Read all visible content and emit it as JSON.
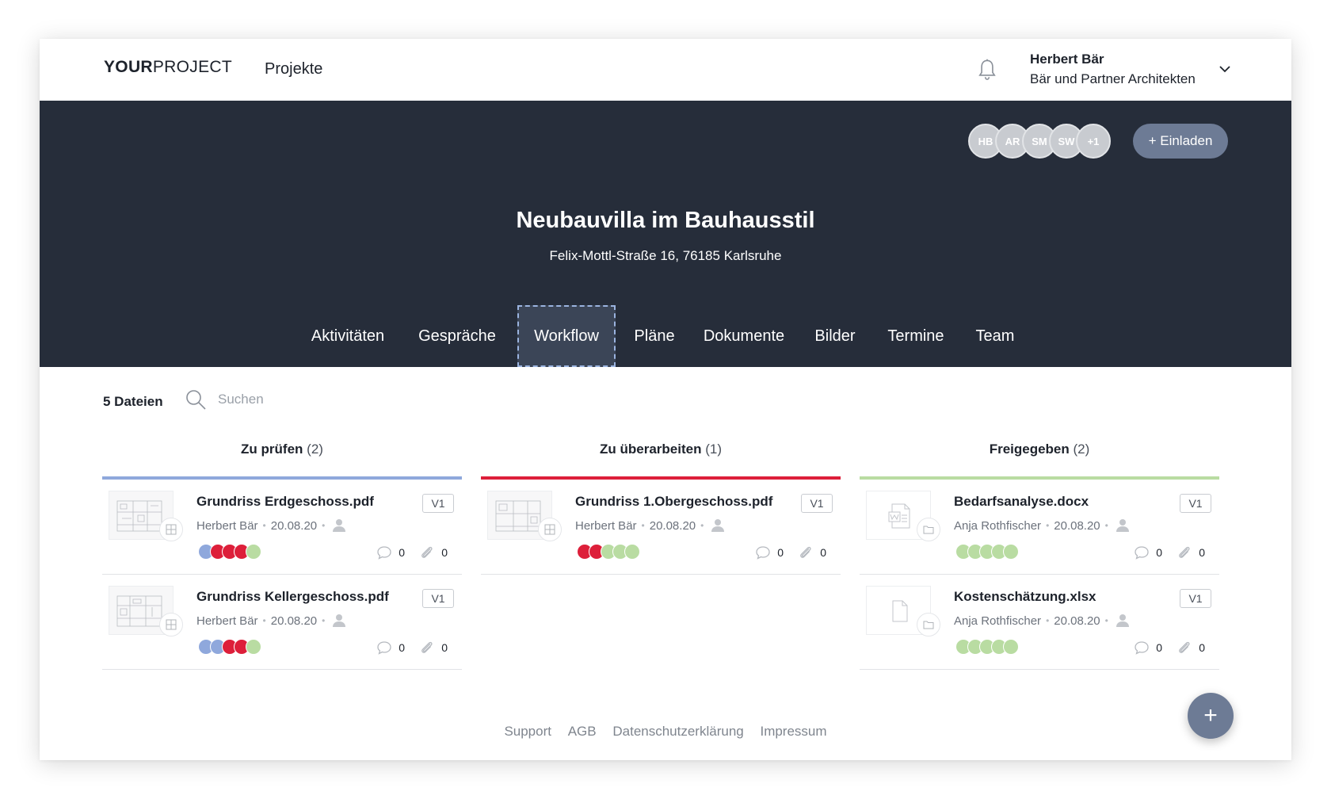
{
  "brand": {
    "bold": "YOUR",
    "light": "PROJECT"
  },
  "topnav": {
    "projects_label": "Projekte"
  },
  "user": {
    "name": "Herbert Bär",
    "organization": "Bär und Partner Architekten"
  },
  "project": {
    "title": "Neubauvilla im Bauhausstil",
    "address": "Felix-Mottl-Straße 16, 76185 Karlsruhe",
    "members": [
      "HB",
      "AR",
      "SM",
      "SW",
      "+1"
    ],
    "invite_label": "+ Einladen"
  },
  "tabs": [
    "Aktivitäten",
    "Gespräche",
    "Workflow",
    "Pläne",
    "Dokumente",
    "Bilder",
    "Termine",
    "Team"
  ],
  "active_tab": "Workflow",
  "toolbar": {
    "file_count": "5 Dateien",
    "search_placeholder": "Suchen"
  },
  "colors": {
    "review": "#8fa8dc",
    "rework": "#dd1f3a",
    "approved": "#b9dca2",
    "hero": "#262d3a",
    "accent": "#6d7b95"
  },
  "columns": [
    {
      "title": "Zu prüfen",
      "count": "(2)",
      "color": "#8fa8dc",
      "cards": [
        {
          "name": "Grundriss Erdgeschoss.pdf",
          "version": "V1",
          "author": "Herbert Bär",
          "date": "20.08.20",
          "thumb": "plan",
          "status_dots": [
            "blue",
            "red",
            "red",
            "red",
            "green"
          ],
          "comments": "0",
          "attachments": "0"
        },
        {
          "name": "Grundriss Kellergeschoss.pdf",
          "version": "V1",
          "author": "Herbert Bär",
          "date": "20.08.20",
          "thumb": "plan",
          "status_dots": [
            "blue",
            "blue",
            "red",
            "red",
            "green"
          ],
          "comments": "0",
          "attachments": "0"
        }
      ]
    },
    {
      "title": "Zu überarbeiten",
      "count": "(1)",
      "color": "#dd1f3a",
      "cards": [
        {
          "name": "Grundriss 1.Obergeschoss.pdf",
          "version": "V1",
          "author": "Herbert Bär",
          "date": "20.08.20",
          "thumb": "plan",
          "status_dots": [
            "red",
            "red",
            "green",
            "green",
            "green"
          ],
          "comments": "0",
          "attachments": "0"
        }
      ]
    },
    {
      "title": "Freigegeben",
      "count": "(2)",
      "color": "#b9dca2",
      "cards": [
        {
          "name": "Bedarfsanalyse.docx",
          "version": "V1",
          "author": "Anja Rothfischer",
          "date": "20.08.20",
          "thumb": "word",
          "status_dots": [
            "green",
            "green",
            "green",
            "green",
            "green"
          ],
          "comments": "0",
          "attachments": "0"
        },
        {
          "name": "Kostenschätzung.xlsx",
          "version": "V1",
          "author": "Anja Rothfischer",
          "date": "20.08.20",
          "thumb": "file",
          "status_dots": [
            "green",
            "green",
            "green",
            "green",
            "green"
          ],
          "comments": "0",
          "attachments": "0"
        }
      ]
    }
  ],
  "footer": {
    "links": [
      "Support",
      "AGB",
      "Datenschutzerklärung",
      "Impressum"
    ]
  },
  "fab": {
    "label": "+"
  }
}
